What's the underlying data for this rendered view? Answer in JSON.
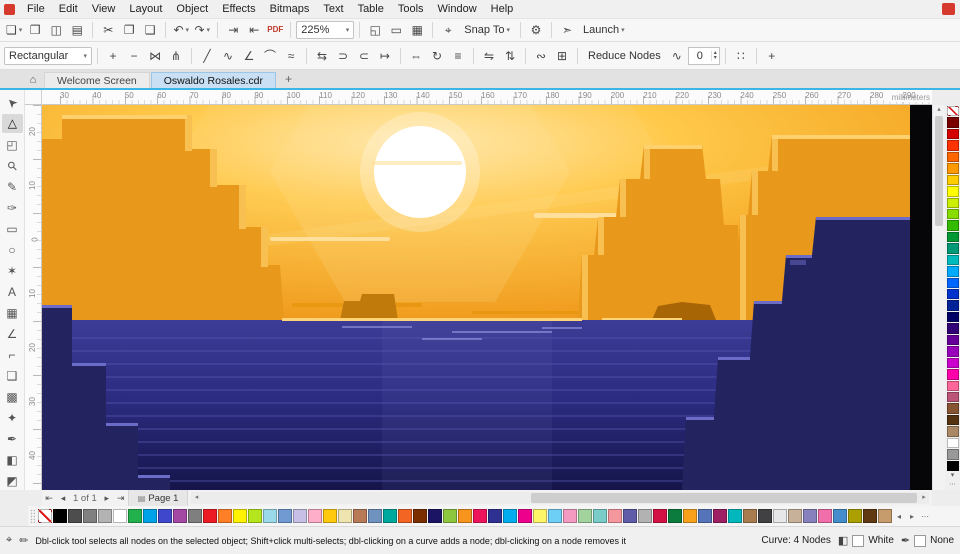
{
  "menu": {
    "items": [
      "File",
      "Edit",
      "View",
      "Layout",
      "Object",
      "Effects",
      "Bitmaps",
      "Text",
      "Table",
      "Tools",
      "Window",
      "Help"
    ]
  },
  "toolbar": {
    "items": [
      {
        "t": "btn",
        "name": "new-document-button",
        "glyph": "❏",
        "dd": true
      },
      {
        "t": "btn",
        "name": "open-button",
        "glyph": "❒"
      },
      {
        "t": "btn",
        "name": "save-button",
        "glyph": "◫"
      },
      {
        "t": "btn",
        "name": "print-button",
        "glyph": "▤"
      },
      {
        "t": "sep"
      },
      {
        "t": "btn",
        "name": "cut-button",
        "glyph": "✂"
      },
      {
        "t": "btn",
        "name": "copy-button",
        "glyph": "❐"
      },
      {
        "t": "btn",
        "name": "paste-button",
        "glyph": "❑"
      },
      {
        "t": "sep"
      },
      {
        "t": "btn",
        "name": "undo-button",
        "glyph": "↶",
        "dd": true
      },
      {
        "t": "btn",
        "name": "redo-button",
        "glyph": "↷",
        "dd": true
      },
      {
        "t": "sep"
      },
      {
        "t": "btn",
        "name": "import-button",
        "glyph": "⇥"
      },
      {
        "t": "btn",
        "name": "export-button",
        "glyph": "⇤"
      },
      {
        "t": "btn",
        "name": "publish-pdf-button",
        "glyph": "PDF",
        "wide": true
      },
      {
        "t": "sep"
      },
      {
        "t": "select",
        "name": "zoom-level-select",
        "value": "225%",
        "w": 58
      },
      {
        "t": "sep"
      },
      {
        "t": "btn",
        "name": "full-screen-preview-button",
        "glyph": "◱"
      },
      {
        "t": "btn",
        "name": "view-rulers-button",
        "glyph": "▭"
      },
      {
        "t": "btn",
        "name": "view-grid-button",
        "glyph": "▦"
      },
      {
        "t": "sep"
      },
      {
        "t": "btn",
        "name": "snap-off-button",
        "glyph": "⌖"
      },
      {
        "t": "text",
        "name": "snap-to-dropdown",
        "label": "Snap To",
        "dd": true
      },
      {
        "t": "sep"
      },
      {
        "t": "btn",
        "name": "options-button",
        "glyph": "⚙"
      },
      {
        "t": "sep"
      },
      {
        "t": "btn",
        "name": "launch-icon-button",
        "glyph": "➣"
      },
      {
        "t": "text",
        "name": "launch-dropdown",
        "label": "Launch",
        "dd": true
      }
    ]
  },
  "property_bar": {
    "items": [
      {
        "t": "select",
        "name": "selection-mode-select",
        "value": "Rectangular",
        "w": 88
      },
      {
        "t": "sep"
      },
      {
        "t": "btn",
        "name": "add-node-button",
        "glyph": "+"
      },
      {
        "t": "btn",
        "name": "delete-node-button",
        "glyph": "−"
      },
      {
        "t": "btn",
        "name": "join-nodes-button",
        "glyph": "⋈"
      },
      {
        "t": "btn",
        "name": "break-curve-button",
        "glyph": "⋔"
      },
      {
        "t": "sep"
      },
      {
        "t": "btn",
        "name": "convert-to-line-button",
        "glyph": "╱"
      },
      {
        "t": "btn",
        "name": "convert-to-curve-button",
        "glyph": "∿"
      },
      {
        "t": "btn",
        "name": "cusp-node-button",
        "glyph": "∠"
      },
      {
        "t": "btn",
        "name": "smooth-node-button",
        "glyph": "⌒"
      },
      {
        "t": "btn",
        "name": "symmetrical-node-button",
        "glyph": "≈"
      },
      {
        "t": "sep"
      },
      {
        "t": "btn",
        "name": "reverse-direction-button",
        "glyph": "⇆"
      },
      {
        "t": "btn",
        "name": "close-curve-button",
        "glyph": "⊃"
      },
      {
        "t": "btn",
        "name": "extract-subpath-button",
        "glyph": "⊂"
      },
      {
        "t": "btn",
        "name": "extend-curve-button",
        "glyph": "↦"
      },
      {
        "t": "sep"
      },
      {
        "t": "btn",
        "name": "stretch-nodes-button",
        "glyph": "⇔"
      },
      {
        "t": "btn",
        "name": "rotate-nodes-button",
        "glyph": "↻"
      },
      {
        "t": "btn",
        "name": "align-nodes-button",
        "glyph": "≡"
      },
      {
        "t": "sep"
      },
      {
        "t": "btn",
        "name": "reflect-horizontal-button",
        "glyph": "⇋"
      },
      {
        "t": "btn",
        "name": "reflect-vertical-button",
        "glyph": "⇅"
      },
      {
        "t": "sep"
      },
      {
        "t": "btn",
        "name": "elastic-mode-button",
        "glyph": "∾"
      },
      {
        "t": "btn",
        "name": "select-all-nodes-button",
        "glyph": "⊞"
      },
      {
        "t": "sep"
      },
      {
        "t": "text",
        "name": "reduce-nodes-button",
        "label": "Reduce Nodes"
      },
      {
        "t": "btn",
        "name": "curve-smoothness-button",
        "glyph": "∿"
      },
      {
        "t": "spin",
        "name": "curve-smoothness-spinner",
        "value": "0"
      },
      {
        "t": "sep"
      },
      {
        "t": "btn",
        "name": "node-alignment-button",
        "glyph": "∷"
      },
      {
        "t": "sep"
      },
      {
        "t": "btn",
        "name": "customize-toolbar-button",
        "glyph": "+"
      }
    ]
  },
  "tabs": {
    "home_icon": "⌂",
    "items": [
      {
        "label": "Welcome Screen"
      },
      {
        "label": "Oswaldo Rosales.cdr"
      }
    ],
    "new_tab_icon": "+"
  },
  "ruler": {
    "unit": "millimeters",
    "h_ticks": [
      "30",
      "40",
      "50",
      "60",
      "70",
      "80",
      "90",
      "100",
      "110",
      "120",
      "130",
      "140",
      "150",
      "160",
      "170",
      "180",
      "190",
      "200",
      "210",
      "220",
      "230",
      "240",
      "250",
      "260",
      "270",
      "280",
      "290"
    ],
    "v_ticks": [
      "20",
      "10",
      "0",
      "10",
      "20",
      "30",
      "40"
    ]
  },
  "toolbox": {
    "items": [
      {
        "name": "pick-tool",
        "glyph": "➤",
        "rot": -135
      },
      {
        "name": "shape-tool",
        "glyph": "▷",
        "rot": -90,
        "active": true
      },
      {
        "name": "crop-tool",
        "glyph": "◰"
      },
      {
        "name": "zoom-tool",
        "glyph": "⚲",
        "rot": -45
      },
      {
        "name": "freehand-tool",
        "glyph": "✎"
      },
      {
        "name": "artistic-media-tool",
        "glyph": "✑"
      },
      {
        "name": "rectangle-tool",
        "glyph": "▭"
      },
      {
        "name": "ellipse-tool",
        "glyph": "○"
      },
      {
        "name": "polygon-tool",
        "glyph": "✶"
      },
      {
        "name": "text-tool",
        "glyph": "A"
      },
      {
        "name": "table-tool",
        "glyph": "▦"
      },
      {
        "name": "dimension-tool",
        "glyph": "∠"
      },
      {
        "name": "connector-tool",
        "glyph": "⌐"
      },
      {
        "name": "shadow-tool",
        "glyph": "❑"
      },
      {
        "name": "transparency-tool",
        "glyph": "▩"
      },
      {
        "name": "eyedropper-tool",
        "glyph": "✦"
      },
      {
        "name": "outline-pen-tool",
        "glyph": "✒"
      },
      {
        "name": "fill-tool",
        "glyph": "◧"
      },
      {
        "name": "interactive-fill-tool",
        "glyph": "◩"
      }
    ]
  },
  "palette_right": {
    "colors": [
      "none",
      "#7a0000",
      "#d40000",
      "#ff3300",
      "#ff6600",
      "#ff9900",
      "#ffcc00",
      "#ffff00",
      "#ccee00",
      "#88dd00",
      "#33bb00",
      "#009933",
      "#009977",
      "#00bbbb",
      "#00aaff",
      "#0066ff",
      "#0033cc",
      "#002299",
      "#000066",
      "#330077",
      "#660099",
      "#9900bb",
      "#cc00cc",
      "#ff00aa",
      "#ff6699",
      "#bb5577",
      "#885533",
      "#553311",
      "#aa8866",
      "#ffffff",
      "#999999",
      "#000000"
    ],
    "down_icon": "▾",
    "more_icon": "⋯"
  },
  "palette_bottom": {
    "colors": [
      "none",
      "#000000",
      "#4d4d4d",
      "#808080",
      "#b3b3b3",
      "#ffffff",
      "#22b14c",
      "#00a2e8",
      "#3f48cc",
      "#a349a4",
      "#7f7f7f",
      "#ed1c24",
      "#ff7f27",
      "#fff200",
      "#b5e61d",
      "#99d9ea",
      "#709ad1",
      "#c8bfe7",
      "#ffaec9",
      "#ffc90e",
      "#efe4b0",
      "#b97a57",
      "#7092be",
      "#00a99d",
      "#f26522",
      "#7b2e00",
      "#1b1464",
      "#8dc63f",
      "#f7941d",
      "#ed145b",
      "#2e3192",
      "#00aeef",
      "#ec008c",
      "#fff568",
      "#6dcff6",
      "#f49ac1",
      "#a3d39c",
      "#7accc8",
      "#f5989d",
      "#605ca8",
      "#b2b2b2",
      "#d31145",
      "#0c7b3e",
      "#f9a11b",
      "#5674b9",
      "#9e1f63",
      "#00b7bd",
      "#a97c50",
      "#414042",
      "#e6e7e8",
      "#c7b299",
      "#8781bd",
      "#f06eaa",
      "#448ccb",
      "#aba000",
      "#603913",
      "#c69c6d"
    ],
    "left_icon": "◂",
    "right_icon": "▸",
    "more_icon": "⋯"
  },
  "scroll": {
    "up": "▴",
    "down": "▾",
    "left": "◂",
    "right": "▸"
  },
  "pagebar": {
    "first_icon": "⇤",
    "prev_icon": "◂",
    "position": "1 of 1",
    "next_icon": "▸",
    "last_icon": "⇥",
    "page_icon": "▤",
    "page_tab": "Page 1"
  },
  "statusbar": {
    "target_icon": "⌖",
    "pen_icon": "✏",
    "hint": "Dbl-click tool selects all nodes on the selected object; Shift+click multi-selects; dbl-clicking on a curve adds a node; dbl-clicking on a node removes it",
    "object_info": "Curve: 4 Nodes",
    "fill_icon": "◧",
    "fill_color": "#ffffff",
    "fill_label": "White",
    "outline_icon": "✒",
    "outline_label": "None"
  },
  "scene": {
    "colors": {
      "sky_center": "#ffeab0",
      "sky_mid": "#ffc94a",
      "sky_outer": "#ee920d",
      "sun": "#ffffff",
      "beam": "#ffe49a",
      "cloud": "#ffdf9a",
      "cloud_dark": "#e8960f",
      "mesa": "#e8991c",
      "mesa_light": "#f8c051",
      "mesa_top": "#ffd06e",
      "mesa_dark": "#c07a0c",
      "mesa_far": "#a86505",
      "water_top": "#3c3c96",
      "water_mid": "#2c2c82",
      "water_bottom": "#15154a",
      "stripe": "#5656b0",
      "glint": "#ffd478",
      "reflect": "#8c8cd8",
      "cliff": "#23235f",
      "cliff_edge": "#6b6bc8"
    }
  }
}
